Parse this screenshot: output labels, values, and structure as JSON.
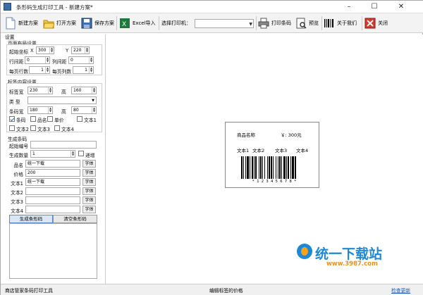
{
  "window": {
    "title": "条形码生成打印工具 - 新建方案*"
  },
  "toolbar": {
    "new": "新建方案",
    "open": "打开方案",
    "save": "保存方案",
    "excel": "Excel导入",
    "printer_label": "选择打印机：",
    "printer_value": "",
    "print": "打印条码",
    "preview": "预览",
    "about": "关于我们",
    "close": "关闭"
  },
  "settings": {
    "title": "设置",
    "page": {
      "title": "页面布局设置",
      "start_label": "起始坐标",
      "x_label": "X",
      "x_value": "300",
      "y_label": "Y",
      "y_value": "220",
      "row_gap_label": "行间距",
      "row_gap_value": "0",
      "col_gap_label": "列间距",
      "col_gap_value": "0",
      "rows_label": "每页行数",
      "rows_value": "1",
      "cols_label": "每页列数",
      "cols_value": "1"
    },
    "label": {
      "title": "标签内容设置",
      "width_label": "标签宽",
      "width_value": "230",
      "height_label": "高",
      "height_value": "160",
      "type_label": "类  型",
      "type_value": "",
      "bar_width_label": "条码宽",
      "bar_width_value": "180",
      "bar_height_label": "高",
      "bar_height_value": "80",
      "checks": [
        {
          "label": "条码",
          "checked": true
        },
        {
          "label": "品名",
          "checked": false
        },
        {
          "label": "单价",
          "checked": false
        },
        {
          "label": "文本1",
          "checked": false
        },
        {
          "label": "文本2",
          "checked": false
        },
        {
          "label": "文本3",
          "checked": false
        },
        {
          "label": "文本4",
          "checked": false
        }
      ]
    },
    "generate": {
      "title": "生成条码",
      "start_no_label": "起始编号",
      "start_no_value": "",
      "qty_label": "生成数量",
      "qty_value": "1",
      "inc_label": "递增",
      "font_btn": "字体",
      "fields": [
        {
          "label": "品名",
          "value": "统一下载"
        },
        {
          "label": "价格",
          "value": "200"
        },
        {
          "label": "文本1",
          "value": "统一下载"
        },
        {
          "label": "文本2",
          "value": ""
        },
        {
          "label": "文本3",
          "value": ""
        },
        {
          "label": "文本4",
          "value": ""
        }
      ],
      "gen_btn": "生成条形码",
      "clear_btn": "清空条形码"
    }
  },
  "preview": {
    "name": "商品名称",
    "price": "￥: 300元",
    "texts": [
      "文本1",
      "文本2",
      "文本3",
      "文本4"
    ],
    "barcode_text": "* 1 2 3 4 5 6 7 8 *"
  },
  "status": {
    "left": "商店管家条码打印工具",
    "middle": "编辑标签的价格",
    "right": "检查更新"
  },
  "watermark": {
    "brand": "统一下载站",
    "url": "www.3987.com"
  }
}
